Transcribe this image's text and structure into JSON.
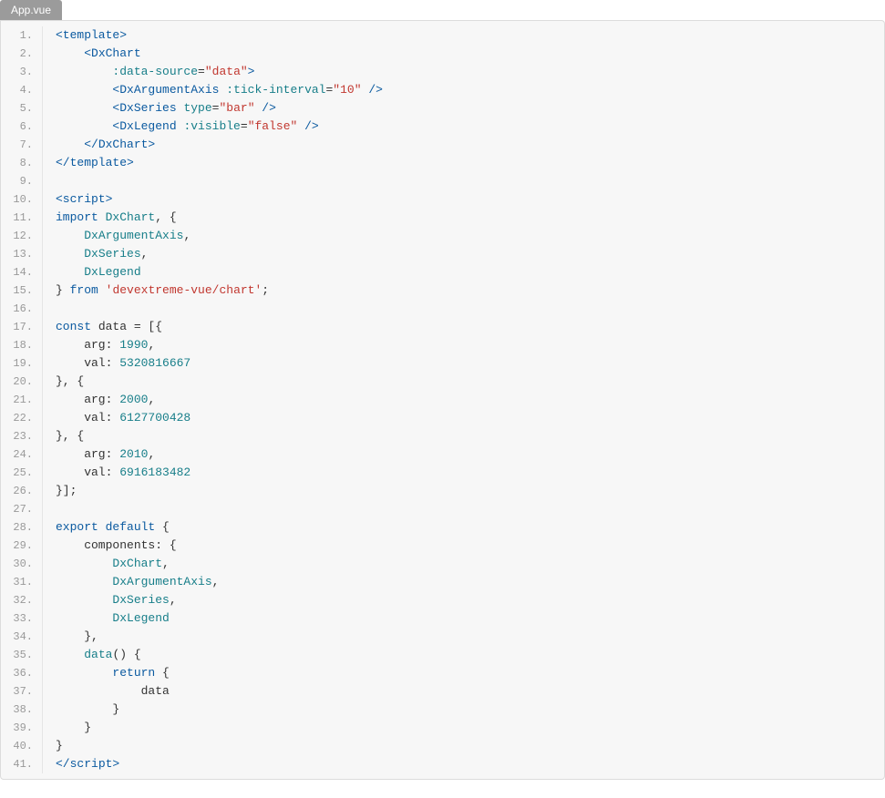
{
  "tab": {
    "label": "App.vue"
  },
  "code": {
    "lines": [
      [
        {
          "t": "<template>",
          "c": "c-tag"
        }
      ],
      [
        {
          "t": "    ",
          "c": ""
        },
        {
          "t": "<DxChart",
          "c": "c-tag"
        }
      ],
      [
        {
          "t": "        ",
          "c": ""
        },
        {
          "t": ":data-source",
          "c": "c-attr"
        },
        {
          "t": "=",
          "c": "c-punc"
        },
        {
          "t": "\"data\"",
          "c": "c-str"
        },
        {
          "t": ">",
          "c": "c-tag"
        }
      ],
      [
        {
          "t": "        ",
          "c": ""
        },
        {
          "t": "<DxArgumentAxis",
          "c": "c-tag"
        },
        {
          "t": " ",
          "c": ""
        },
        {
          "t": ":tick-interval",
          "c": "c-attr"
        },
        {
          "t": "=",
          "c": "c-punc"
        },
        {
          "t": "\"10\"",
          "c": "c-str"
        },
        {
          "t": " />",
          "c": "c-tag"
        }
      ],
      [
        {
          "t": "        ",
          "c": ""
        },
        {
          "t": "<DxSeries",
          "c": "c-tag"
        },
        {
          "t": " ",
          "c": ""
        },
        {
          "t": "type",
          "c": "c-attr"
        },
        {
          "t": "=",
          "c": "c-punc"
        },
        {
          "t": "\"bar\"",
          "c": "c-str"
        },
        {
          "t": " />",
          "c": "c-tag"
        }
      ],
      [
        {
          "t": "        ",
          "c": ""
        },
        {
          "t": "<DxLegend",
          "c": "c-tag"
        },
        {
          "t": " ",
          "c": ""
        },
        {
          "t": ":visible",
          "c": "c-attr"
        },
        {
          "t": "=",
          "c": "c-punc"
        },
        {
          "t": "\"false\"",
          "c": "c-str"
        },
        {
          "t": " />",
          "c": "c-tag"
        }
      ],
      [
        {
          "t": "    ",
          "c": ""
        },
        {
          "t": "</DxChart>",
          "c": "c-tag"
        }
      ],
      [
        {
          "t": "</template>",
          "c": "c-tag"
        }
      ],
      [
        {
          "t": "",
          "c": ""
        }
      ],
      [
        {
          "t": "<script>",
          "c": "c-tag"
        }
      ],
      [
        {
          "t": "import",
          "c": "c-kw"
        },
        {
          "t": " ",
          "c": ""
        },
        {
          "t": "DxChart",
          "c": "c-attr"
        },
        {
          "t": ", {",
          "c": "c-punc"
        }
      ],
      [
        {
          "t": "    ",
          "c": ""
        },
        {
          "t": "DxArgumentAxis",
          "c": "c-attr"
        },
        {
          "t": ",",
          "c": "c-punc"
        }
      ],
      [
        {
          "t": "    ",
          "c": ""
        },
        {
          "t": "DxSeries",
          "c": "c-attr"
        },
        {
          "t": ",",
          "c": "c-punc"
        }
      ],
      [
        {
          "t": "    ",
          "c": ""
        },
        {
          "t": "DxLegend",
          "c": "c-attr"
        }
      ],
      [
        {
          "t": "} ",
          "c": "c-punc"
        },
        {
          "t": "from",
          "c": "c-kw"
        },
        {
          "t": " ",
          "c": ""
        },
        {
          "t": "'devextreme-vue/chart'",
          "c": "c-str"
        },
        {
          "t": ";",
          "c": "c-punc"
        }
      ],
      [
        {
          "t": "",
          "c": ""
        }
      ],
      [
        {
          "t": "const",
          "c": "c-kw"
        },
        {
          "t": " data = [{",
          "c": "c-punc"
        }
      ],
      [
        {
          "t": "    arg: ",
          "c": "c-punc"
        },
        {
          "t": "1990",
          "c": "c-num"
        },
        {
          "t": ",",
          "c": "c-punc"
        }
      ],
      [
        {
          "t": "    val: ",
          "c": "c-punc"
        },
        {
          "t": "5320816667",
          "c": "c-num"
        }
      ],
      [
        {
          "t": "}, {",
          "c": "c-punc"
        }
      ],
      [
        {
          "t": "    arg: ",
          "c": "c-punc"
        },
        {
          "t": "2000",
          "c": "c-num"
        },
        {
          "t": ",",
          "c": "c-punc"
        }
      ],
      [
        {
          "t": "    val: ",
          "c": "c-punc"
        },
        {
          "t": "6127700428",
          "c": "c-num"
        }
      ],
      [
        {
          "t": "}, {",
          "c": "c-punc"
        }
      ],
      [
        {
          "t": "    arg: ",
          "c": "c-punc"
        },
        {
          "t": "2010",
          "c": "c-num"
        },
        {
          "t": ",",
          "c": "c-punc"
        }
      ],
      [
        {
          "t": "    val: ",
          "c": "c-punc"
        },
        {
          "t": "6916183482",
          "c": "c-num"
        }
      ],
      [
        {
          "t": "}];",
          "c": "c-punc"
        }
      ],
      [
        {
          "t": "",
          "c": ""
        }
      ],
      [
        {
          "t": "export default",
          "c": "c-kw"
        },
        {
          "t": " {",
          "c": "c-punc"
        }
      ],
      [
        {
          "t": "    components: {",
          "c": "c-punc"
        }
      ],
      [
        {
          "t": "        ",
          "c": ""
        },
        {
          "t": "DxChart",
          "c": "c-attr"
        },
        {
          "t": ",",
          "c": "c-punc"
        }
      ],
      [
        {
          "t": "        ",
          "c": ""
        },
        {
          "t": "DxArgumentAxis",
          "c": "c-attr"
        },
        {
          "t": ",",
          "c": "c-punc"
        }
      ],
      [
        {
          "t": "        ",
          "c": ""
        },
        {
          "t": "DxSeries",
          "c": "c-attr"
        },
        {
          "t": ",",
          "c": "c-punc"
        }
      ],
      [
        {
          "t": "        ",
          "c": ""
        },
        {
          "t": "DxLegend",
          "c": "c-attr"
        }
      ],
      [
        {
          "t": "    },",
          "c": "c-punc"
        }
      ],
      [
        {
          "t": "    ",
          "c": ""
        },
        {
          "t": "data",
          "c": "c-attr"
        },
        {
          "t": "() {",
          "c": "c-punc"
        }
      ],
      [
        {
          "t": "        ",
          "c": ""
        },
        {
          "t": "return",
          "c": "c-kw"
        },
        {
          "t": " {",
          "c": "c-punc"
        }
      ],
      [
        {
          "t": "            data",
          "c": "c-punc"
        }
      ],
      [
        {
          "t": "        }",
          "c": "c-punc"
        }
      ],
      [
        {
          "t": "    }",
          "c": "c-punc"
        }
      ],
      [
        {
          "t": "}",
          "c": "c-punc"
        }
      ],
      [
        {
          "t": "</scr",
          "c": "c-tag"
        },
        {
          "t": "ipt>",
          "c": "c-tag"
        }
      ]
    ]
  }
}
